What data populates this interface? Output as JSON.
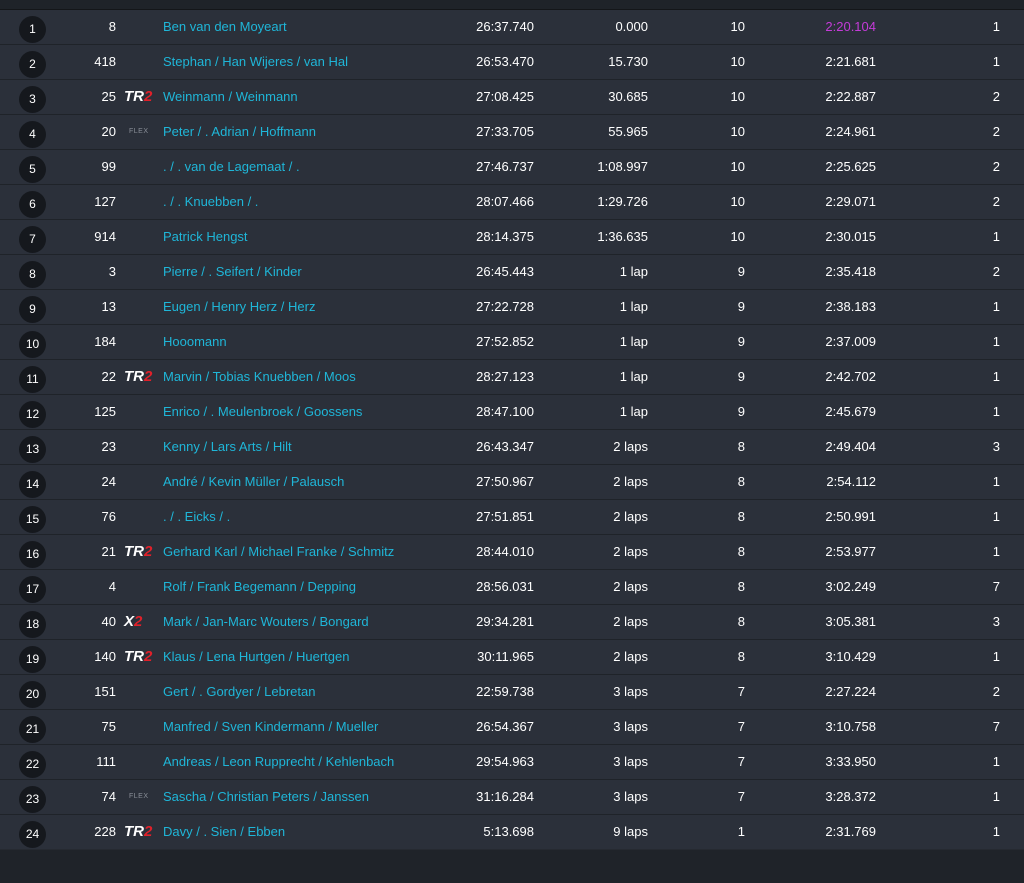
{
  "colors": {
    "link": "#1fb6d8",
    "fastest_lap": "#c43bd8",
    "row_bg": "#2b303a",
    "page_bg": "#1f2329"
  },
  "rows": [
    {
      "pos": "1",
      "num": "8",
      "class": "",
      "driver": "Ben van den Moyeart",
      "time": "26:37.740",
      "gap": "0.000",
      "laps": "10",
      "best": "2:20.104",
      "best_fastest": true,
      "pits": "1"
    },
    {
      "pos": "2",
      "num": "418",
      "class": "",
      "driver": "Stephan / Han Wijeres / van Hal",
      "time": "26:53.470",
      "gap": "15.730",
      "laps": "10",
      "best": "2:21.681",
      "pits": "1"
    },
    {
      "pos": "3",
      "num": "25",
      "class": "TR2",
      "driver": "Weinmann / Weinmann",
      "time": "27:08.425",
      "gap": "30.685",
      "laps": "10",
      "best": "2:22.887",
      "pits": "2"
    },
    {
      "pos": "4",
      "num": "20",
      "class": "FLEX",
      "driver": "Peter / . Adrian / Hoffmann",
      "time": "27:33.705",
      "gap": "55.965",
      "laps": "10",
      "best": "2:24.961",
      "pits": "2"
    },
    {
      "pos": "5",
      "num": "99",
      "class": "",
      "driver": ". / . van de Lagemaat / .",
      "time": "27:46.737",
      "gap": "1:08.997",
      "laps": "10",
      "best": "2:25.625",
      "pits": "2"
    },
    {
      "pos": "6",
      "num": "127",
      "class": "",
      "driver": ". / . Knuebben / .",
      "time": "28:07.466",
      "gap": "1:29.726",
      "laps": "10",
      "best": "2:29.071",
      "pits": "2"
    },
    {
      "pos": "7",
      "num": "914",
      "class": "",
      "driver": "Patrick Hengst",
      "time": "28:14.375",
      "gap": "1:36.635",
      "laps": "10",
      "best": "2:30.015",
      "pits": "1"
    },
    {
      "pos": "8",
      "num": "3",
      "class": "",
      "driver": "Pierre / . Seifert / Kinder",
      "time": "26:45.443",
      "gap": "1 lap",
      "laps": "9",
      "best": "2:35.418",
      "pits": "2"
    },
    {
      "pos": "9",
      "num": "13",
      "class": "",
      "driver": "Eugen / Henry Herz / Herz",
      "time": "27:22.728",
      "gap": "1 lap",
      "laps": "9",
      "best": "2:38.183",
      "pits": "1"
    },
    {
      "pos": "10",
      "num": "184",
      "class": "",
      "driver": "Hooomann",
      "time": "27:52.852",
      "gap": "1 lap",
      "laps": "9",
      "best": "2:37.009",
      "pits": "1"
    },
    {
      "pos": "11",
      "num": "22",
      "class": "TR2",
      "driver": "Marvin / Tobias Knuebben / Moos",
      "time": "28:27.123",
      "gap": "1 lap",
      "laps": "9",
      "best": "2:42.702",
      "pits": "1"
    },
    {
      "pos": "12",
      "num": "125",
      "class": "",
      "driver": "Enrico / . Meulenbroek / Goossens",
      "time": "28:47.100",
      "gap": "1 lap",
      "laps": "9",
      "best": "2:45.679",
      "pits": "1"
    },
    {
      "pos": "13",
      "num": "23",
      "class": "",
      "driver": "Kenny / Lars Arts / Hilt",
      "time": "26:43.347",
      "gap": "2 laps",
      "laps": "8",
      "best": "2:49.404",
      "pits": "3"
    },
    {
      "pos": "14",
      "num": "24",
      "class": "",
      "driver": "André / Kevin Müller / Palausch",
      "time": "27:50.967",
      "gap": "2 laps",
      "laps": "8",
      "best": "2:54.112",
      "pits": "1"
    },
    {
      "pos": "15",
      "num": "76",
      "class": "",
      "driver": ". / . Eicks / .",
      "time": "27:51.851",
      "gap": "2 laps",
      "laps": "8",
      "best": "2:50.991",
      "pits": "1"
    },
    {
      "pos": "16",
      "num": "21",
      "class": "TR2",
      "driver": "Gerhard Karl / Michael Franke / Schmitz",
      "time": "28:44.010",
      "gap": "2 laps",
      "laps": "8",
      "best": "2:53.977",
      "pits": "1"
    },
    {
      "pos": "17",
      "num": "4",
      "class": "",
      "driver": "Rolf / Frank Begemann / Depping",
      "time": "28:56.031",
      "gap": "2 laps",
      "laps": "8",
      "best": "3:02.249",
      "pits": "7"
    },
    {
      "pos": "18",
      "num": "40",
      "class": "X2",
      "driver": "Mark / Jan-Marc Wouters / Bongard",
      "time": "29:34.281",
      "gap": "2 laps",
      "laps": "8",
      "best": "3:05.381",
      "pits": "3"
    },
    {
      "pos": "19",
      "num": "140",
      "class": "TR2",
      "driver": "Klaus / Lena Hurtgen / Huertgen",
      "time": "30:11.965",
      "gap": "2 laps",
      "laps": "8",
      "best": "3:10.429",
      "pits": "1"
    },
    {
      "pos": "20",
      "num": "151",
      "class": "",
      "driver": "Gert / . Gordyer / Lebretan",
      "time": "22:59.738",
      "gap": "3 laps",
      "laps": "7",
      "best": "2:27.224",
      "pits": "2"
    },
    {
      "pos": "21",
      "num": "75",
      "class": "",
      "driver": "Manfred / Sven Kindermann / Mueller",
      "time": "26:54.367",
      "gap": "3 laps",
      "laps": "7",
      "best": "3:10.758",
      "pits": "7"
    },
    {
      "pos": "22",
      "num": "111",
      "class": "",
      "driver": "Andreas / Leon Rupprecht / Kehlenbach",
      "time": "29:54.963",
      "gap": "3 laps",
      "laps": "7",
      "best": "3:33.950",
      "pits": "1"
    },
    {
      "pos": "23",
      "num": "74",
      "class": "FLEX",
      "driver": "Sascha / Christian Peters / Janssen",
      "time": "31:16.284",
      "gap": "3 laps",
      "laps": "7",
      "best": "3:28.372",
      "pits": "1"
    },
    {
      "pos": "24",
      "num": "228",
      "class": "TR2",
      "driver": "Davy / . Sien / Ebben",
      "time": "5:13.698",
      "gap": "9 laps",
      "laps": "1",
      "best": "2:31.769",
      "pits": "1"
    }
  ]
}
